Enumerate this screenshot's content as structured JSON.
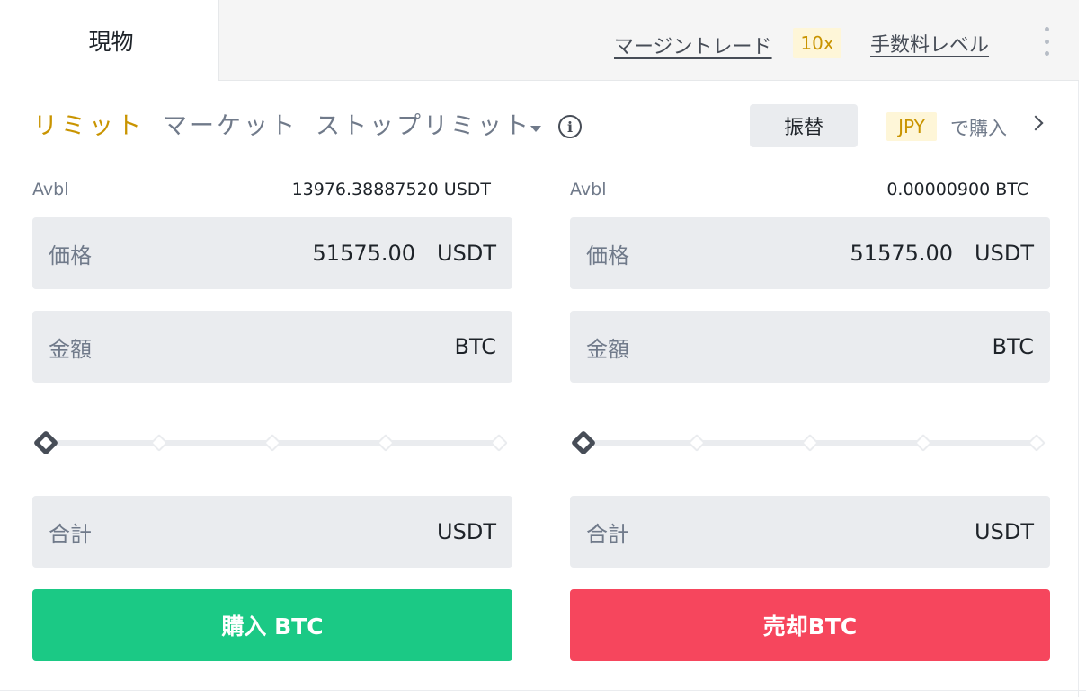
{
  "tabs": {
    "spot": "現物",
    "margin_link": "マージントレード",
    "leverage": "10x",
    "fee_link": "手数料レベル"
  },
  "order_types": {
    "limit": "リミット",
    "market": "マーケット",
    "stop_limit": "ストップリミット"
  },
  "transfer_label": "振替",
  "buy_with": {
    "currency": "JPY",
    "label": "で購入"
  },
  "buy": {
    "avbl_label": "Avbl",
    "avbl_value": "13976.38887520 USDT",
    "price_label": "価格",
    "price_value": "51575.00",
    "price_unit": "USDT",
    "amount_label": "金額",
    "amount_unit": "BTC",
    "total_label": "合計",
    "total_unit": "USDT",
    "slider_percent": 0,
    "button_label": "購入 BTC"
  },
  "sell": {
    "avbl_label": "Avbl",
    "avbl_value": "0.00000900 BTC",
    "price_label": "価格",
    "price_value": "51575.00",
    "price_unit": "USDT",
    "amount_label": "金額",
    "amount_unit": "BTC",
    "total_label": "合計",
    "total_unit": "USDT",
    "slider_percent": 0,
    "button_label": "売却BTC"
  },
  "colors": {
    "accent": "#c99400",
    "buy": "#1bc985",
    "sell": "#f6465d",
    "field_bg": "#eaecef"
  }
}
